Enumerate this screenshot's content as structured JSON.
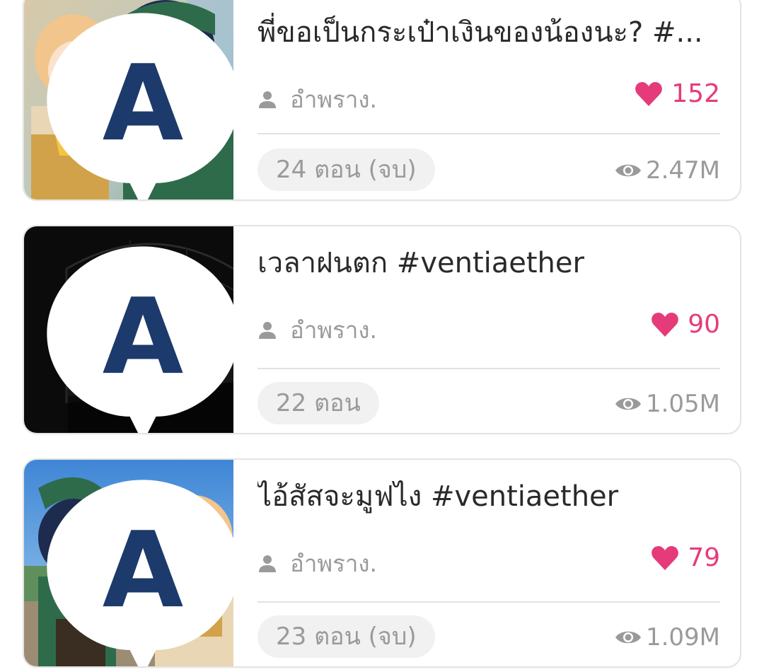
{
  "stories": [
    {
      "title": "พี่ขอเป็นกระเป๋าเงินของน้องนะ? #...",
      "author": "อำพราง.",
      "likes": "152",
      "episodes": "24 ตอน (จบ)",
      "views": "2.47M",
      "cover_icon": "anime-characters-cover"
    },
    {
      "title": "เวลาฝนตก #ventiaether",
      "author": "อำพราง.",
      "likes": "90",
      "episodes": "22 ตอน",
      "views": "1.05M",
      "cover_icon": "dark-greenhouse-cover"
    },
    {
      "title": "ไอ้สัสจะมูฟไง #ventiaether",
      "author": "อำพราง.",
      "likes": "79",
      "episodes": "23 ตอน (จบ)",
      "views": "1.09M",
      "cover_icon": "anime-characters-cover"
    }
  ],
  "colors": {
    "accent_pink": "#e63b7a",
    "muted_text": "#9a9a9a",
    "title_text": "#2a2a2a",
    "pill_bg": "#f1f1f1",
    "card_border": "#e4e4e4"
  }
}
